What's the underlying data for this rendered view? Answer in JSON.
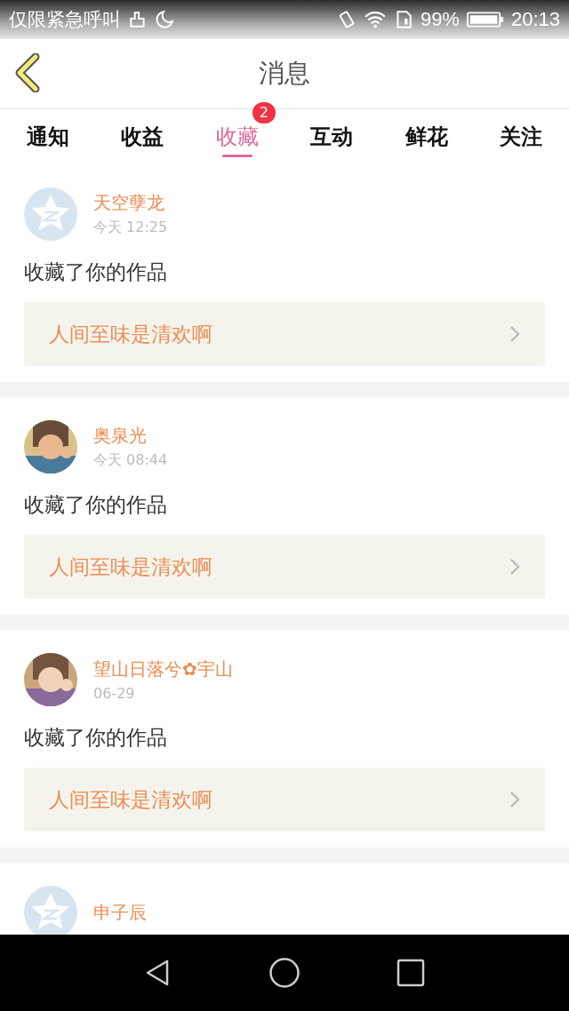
{
  "status_bar": {
    "carrier": "仅限紧急呼叫",
    "battery": "99%",
    "time": "20:13"
  },
  "header": {
    "title": "消息"
  },
  "tabs": [
    {
      "label": "通知",
      "selected": false
    },
    {
      "label": "收益",
      "selected": false
    },
    {
      "label": "收藏",
      "selected": true,
      "badge": "2"
    },
    {
      "label": "互动",
      "selected": false
    },
    {
      "label": "鲜花",
      "selected": false
    },
    {
      "label": "关注",
      "selected": false
    }
  ],
  "messages": [
    {
      "avatar": {
        "kind": "default"
      },
      "name": "天空孽龙",
      "time": "今天 12:25",
      "action": "收藏了你的作品",
      "work": "人间至味是清欢啊"
    },
    {
      "name": "奥泉光",
      "time": "今天 08:44",
      "action": "收藏了你的作品",
      "work": "人间至味是清欢啊"
    },
    {
      "name": "望山日落兮✿宇山",
      "time": "06-29",
      "action": "收藏了你的作品",
      "work": "人间至味是清欢啊"
    },
    {
      "avatar": {
        "kind": "default"
      },
      "name": "申子辰"
    }
  ]
}
